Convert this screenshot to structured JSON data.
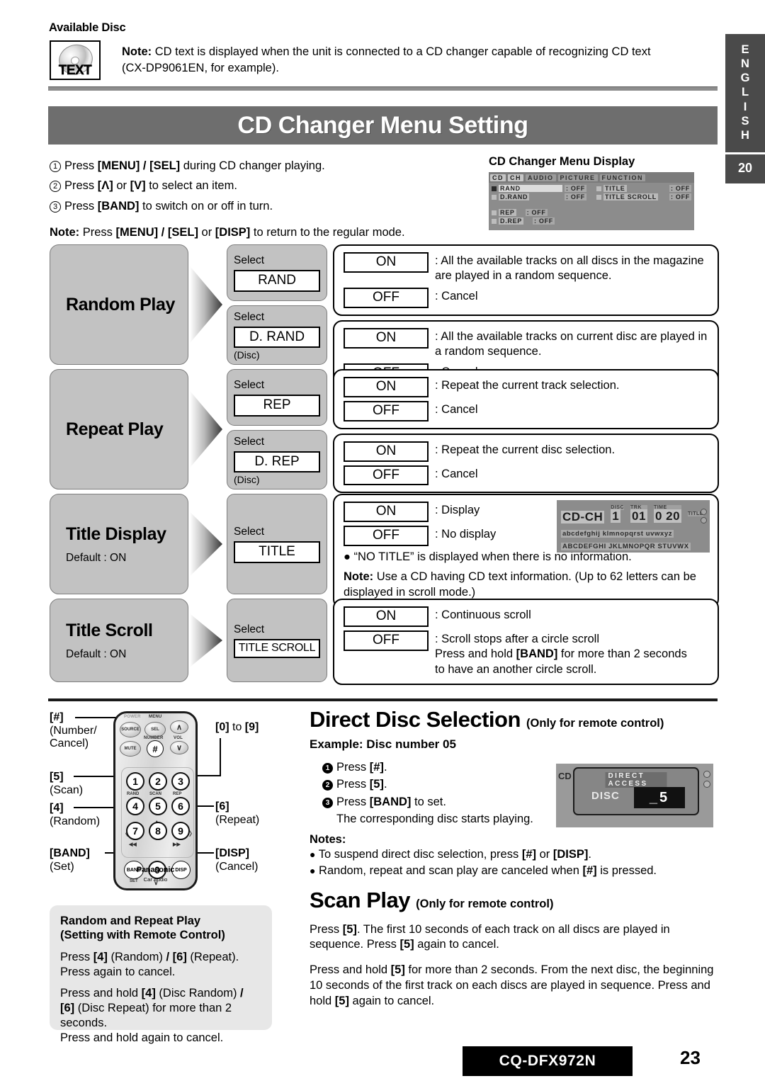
{
  "available_disc": {
    "heading": "Available Disc",
    "icon_label": "TEXT",
    "note_bold": "Note:",
    "note_text": " CD text is displayed when the unit is connected to a CD changer capable of recognizing CD text (CX-DP9061EN, for example)."
  },
  "side_tab": {
    "letters": [
      "E",
      "N",
      "G",
      "L",
      "I",
      "S",
      "H"
    ],
    "page_ref": "20"
  },
  "banner": {
    "title": "CD Changer Menu Setting"
  },
  "steps": [
    {
      "num": "1",
      "html": "Press <b>[MENU] / [SEL]</b> during CD changer playing."
    },
    {
      "num": "2",
      "html": "Press <b>[Λ]</b> or <b>[V]</b> to select an item."
    },
    {
      "num": "3",
      "html": "Press <b>[BAND]</b> to switch on or off in turn."
    }
  ],
  "steps_note": "<b>Note:</b> Press <b>[MENU] / [SEL]</b> or <b>[DISP]</b> to return to the regular mode.",
  "menu_display": {
    "title": "CD Changer Menu Display",
    "tabs": [
      "CD",
      "CH",
      "AUDIO",
      "PICTURE",
      "FUNCTION"
    ],
    "rows": [
      {
        "left_name": "RAND",
        "left_value": ": OFF",
        "right_name": "TITLE",
        "right_value": ": OFF"
      },
      {
        "left_name": "D.RAND",
        "left_value": ": OFF",
        "right_name": "TITLE SCROLL",
        "right_value": ": OFF"
      }
    ],
    "lower_rows": [
      {
        "name": "REP",
        "value": ": OFF"
      },
      {
        "name": "D.REP",
        "value": ": OFF"
      }
    ]
  },
  "table": {
    "select_label": "Select",
    "disc_label": "(Disc)",
    "on_label": "ON",
    "off_label": "OFF",
    "rows": [
      {
        "category": "Random Play",
        "default": "",
        "items": [
          {
            "code": "RAND",
            "disc": false,
            "on_desc": ": All the available tracks on all discs in the magazine are played in a random sequence.",
            "off_desc": ": Cancel"
          },
          {
            "code": "D. RAND",
            "disc": true,
            "on_desc": ": All the available tracks on current disc are played in a random sequence.",
            "off_desc": ": Cancel"
          }
        ]
      },
      {
        "category": "Repeat Play",
        "default": "",
        "items": [
          {
            "code": "REP",
            "disc": false,
            "on_desc": ": Repeat the current track selection.",
            "off_desc": ": Cancel"
          },
          {
            "code": "D. REP",
            "disc": true,
            "on_desc": ": Repeat the current disc selection.",
            "off_desc": ": Cancel"
          }
        ]
      },
      {
        "category": "Title Display",
        "default": "Default : ON",
        "items": [
          {
            "code": "TITLE",
            "disc": false,
            "on_desc": ": Display",
            "off_desc": ": No display",
            "bullet": "● “NO TITLE” is displayed when there is no information.",
            "extra": "<b>Note:</b> Use a CD having CD text information. (Up to 62 letters can be displayed in scroll mode.)"
          }
        ]
      },
      {
        "category": "Title Scroll",
        "default": "Default : ON",
        "items": [
          {
            "code": "TITLE SCROLL",
            "disc": false,
            "on_desc": ": Continuous scroll",
            "off_desc": ": Scroll stops after a circle scroll<br>Press and hold <b>[BAND]</b> for more than 2 seconds<br>to have an another circle scroll."
          }
        ]
      }
    ]
  },
  "title_lcd": {
    "source": "CD-CH",
    "tiny_disc": "DISC",
    "disc_num": "1",
    "tiny_track": "TRK",
    "track_num": "01",
    "tiny_time": "TIME",
    "time": "0 20",
    "tiny_right": "TITLE",
    "scroll_line1": "abcdefghij klmnopqrst uvwxyz",
    "scroll_line2": "ABCDEFGHI JKLMNOPQR STUVWX"
  },
  "remote": {
    "buttons": {
      "source": "SOURCE",
      "sel": "SEL",
      "mute": "MUTE",
      "hash": "#",
      "band": "BAND",
      "disp": "DISP",
      "zero": "0"
    },
    "labels": {
      "power": "POWER",
      "menu": "MENU",
      "number": "NUMBER",
      "vol": "VOL",
      "rand": "RAND",
      "scan": "SCAN",
      "rep": "REP",
      "set": "SET"
    },
    "keys": [
      "1",
      "2",
      "3",
      "4",
      "5",
      "6",
      "7",
      "8",
      "9"
    ],
    "brand": "Panasonic",
    "brand_sub": "Car Audio",
    "callouts": {
      "hash": "[#]",
      "hash_sub1": "(Number/",
      "hash_sub2": "Cancel)",
      "five": "[5]",
      "five_sub": "(Scan)",
      "four": "[4]",
      "four_sub": "(Random)",
      "band": "[BAND]",
      "band_sub": "(Set)",
      "zero_to_nine_a": "[0]",
      "zero_to_nine_mid": " to ",
      "zero_to_nine_b": "[9]",
      "six": "[6]",
      "six_sub": "(Repeat)",
      "disp": "[DISP]",
      "disp_sub": "(Cancel)"
    }
  },
  "random_repeat_box": {
    "title_line1": "Random and Repeat Play",
    "title_line2": "(Setting with Remote Control)",
    "p1": "Press <b>[4]</b> (Random) <b>/</b> <b>[6]</b> (Repeat).<br>Press again to cancel.",
    "p2": "Press and hold <b>[4]</b> (Disc Random) <b>/</b><br><b>[6]</b> (Disc Repeat) for more than 2<br>seconds.<br>Press and hold again to cancel."
  },
  "direct_disc": {
    "heading": "Direct Disc Selection",
    "heading_sub": "(Only for remote control)",
    "example": "Example: Disc number 05",
    "steps": [
      {
        "num": "1",
        "html": "Press <b>[#]</b>."
      },
      {
        "num": "2",
        "html": "Press <b>[5]</b>."
      },
      {
        "num": "3",
        "html": "Press <b>[BAND]</b> to set."
      }
    ],
    "step3_sub": "The corresponding disc starts playing.",
    "notes_heading": "Notes:",
    "notes": [
      "To suspend direct disc selection, press <b>[#]</b> or <b>[DISP]</b>.",
      "Random, repeat and scan play are canceled when <b>[#]</b> is pressed."
    ],
    "lcd": {
      "banner": "DIRECT ACCESS",
      "disc_word": "DISC",
      "number": "_5"
    }
  },
  "scan_play": {
    "heading": "Scan Play",
    "heading_sub": "(Only for remote control)",
    "p1": "Press <b>[5]</b>.  The first 10 seconds of each track on all discs are played in sequence.  Press <b>[5]</b> again to cancel.",
    "p2": "Press and hold <b>[5]</b> for more than 2 seconds.  From the next disc, the beginning 10 seconds of the first track on each discs are played in sequence.  Press and hold <b>[5]</b> again to cancel."
  },
  "footer": {
    "model": "CQ-DFX972N",
    "page": "23"
  }
}
